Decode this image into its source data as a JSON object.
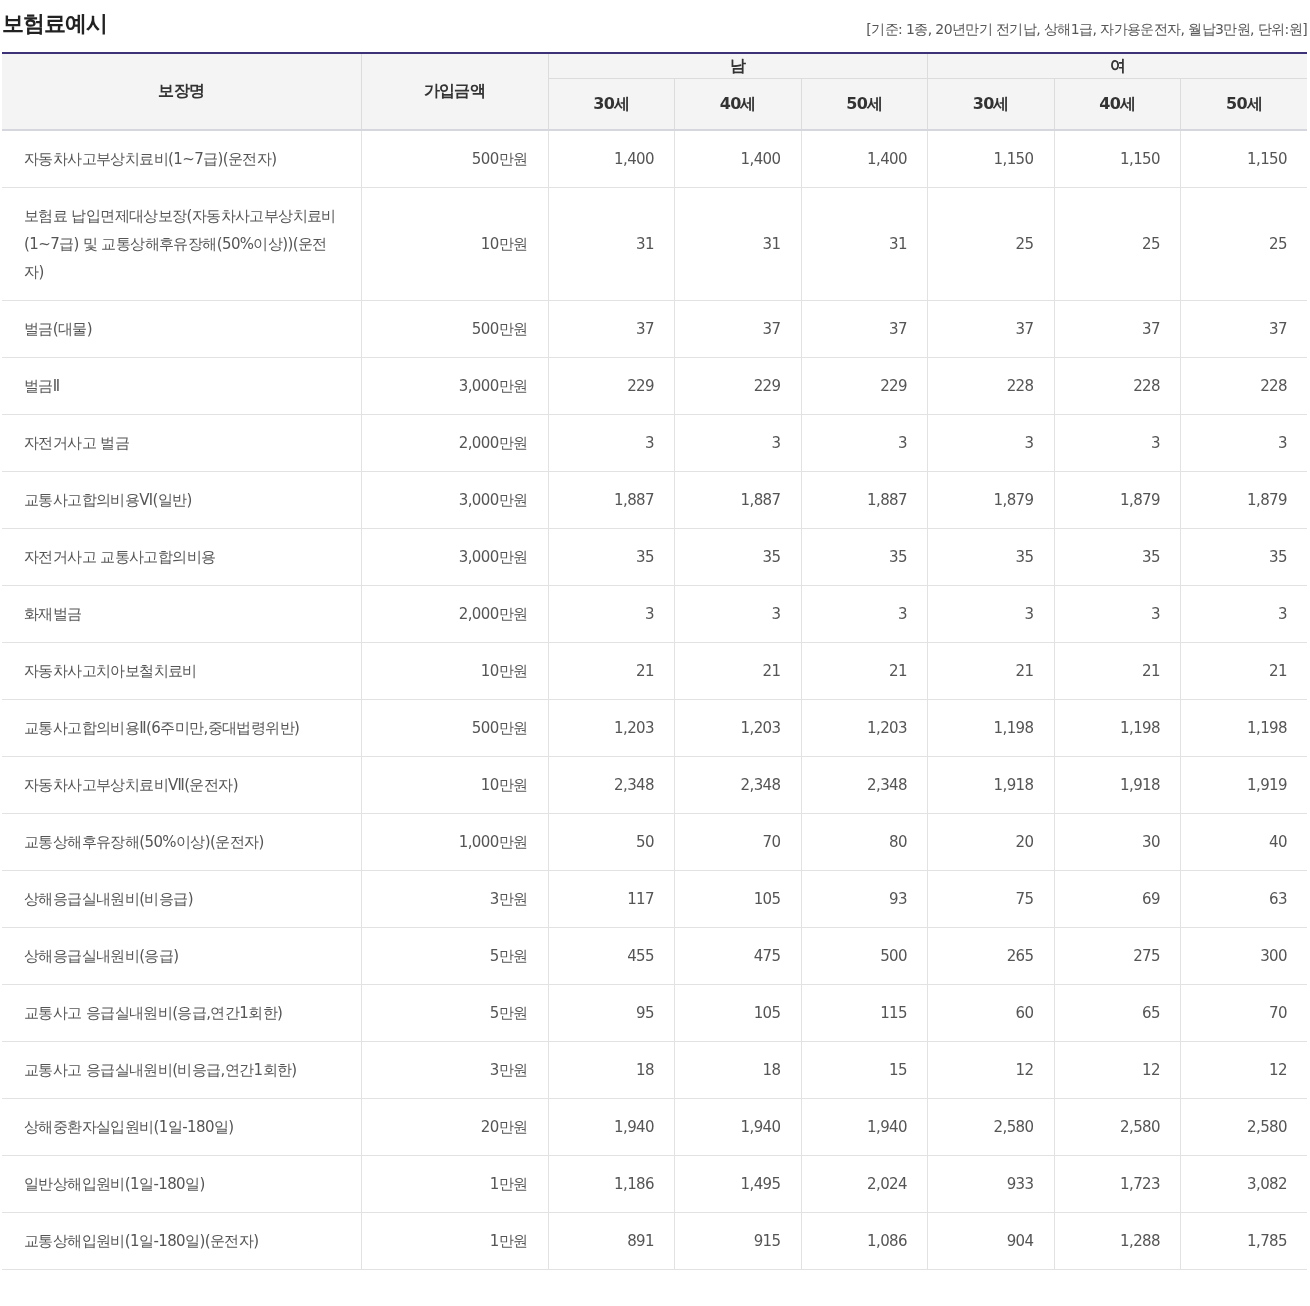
{
  "title": "보험료예시",
  "note": "[기준: 1종, 20년만기 전기납, 상해1급, 자가용운전자, 월납3만원, 단위:원]",
  "table": {
    "columns": {
      "coverage": "보장명",
      "amount": "가입금액",
      "groups": [
        {
          "label": "남",
          "ages": [
            "30세",
            "40세",
            "50세"
          ]
        },
        {
          "label": "여",
          "ages": [
            "30세",
            "40세",
            "50세"
          ]
        }
      ]
    },
    "rows": [
      {
        "name": "자동차사고부상치료비(1~7급)(운전자)",
        "amount": "500만원",
        "values": [
          "1,400",
          "1,400",
          "1,400",
          "1,150",
          "1,150",
          "1,150"
        ]
      },
      {
        "name": "보험료 납입면제대상보장(자동차사고부상치료비(1~7급) 및 교통상해후유장해(50%이상))(운전자)",
        "amount": "10만원",
        "values": [
          "31",
          "31",
          "31",
          "25",
          "25",
          "25"
        ]
      },
      {
        "name": "벌금(대물)",
        "amount": "500만원",
        "values": [
          "37",
          "37",
          "37",
          "37",
          "37",
          "37"
        ]
      },
      {
        "name": "벌금Ⅱ",
        "amount": "3,000만원",
        "values": [
          "229",
          "229",
          "229",
          "228",
          "228",
          "228"
        ]
      },
      {
        "name": "자전거사고 벌금",
        "amount": "2,000만원",
        "values": [
          "3",
          "3",
          "3",
          "3",
          "3",
          "3"
        ]
      },
      {
        "name": "교통사고합의비용Ⅵ(일반)",
        "amount": "3,000만원",
        "values": [
          "1,887",
          "1,887",
          "1,887",
          "1,879",
          "1,879",
          "1,879"
        ]
      },
      {
        "name": "자전거사고 교통사고합의비용",
        "amount": "3,000만원",
        "values": [
          "35",
          "35",
          "35",
          "35",
          "35",
          "35"
        ]
      },
      {
        "name": "화재벌금",
        "amount": "2,000만원",
        "values": [
          "3",
          "3",
          "3",
          "3",
          "3",
          "3"
        ]
      },
      {
        "name": "자동차사고치아보철치료비",
        "amount": "10만원",
        "values": [
          "21",
          "21",
          "21",
          "21",
          "21",
          "21"
        ]
      },
      {
        "name": "교통사고합의비용Ⅱ(6주미만,중대법령위반)",
        "amount": "500만원",
        "values": [
          "1,203",
          "1,203",
          "1,203",
          "1,198",
          "1,198",
          "1,198"
        ]
      },
      {
        "name": "자동차사고부상치료비Ⅶ(운전자)",
        "amount": "10만원",
        "values": [
          "2,348",
          "2,348",
          "2,348",
          "1,918",
          "1,918",
          "1,919"
        ]
      },
      {
        "name": "교통상해후유장해(50%이상)(운전자)",
        "amount": "1,000만원",
        "values": [
          "50",
          "70",
          "80",
          "20",
          "30",
          "40"
        ]
      },
      {
        "name": "상해응급실내원비(비응급)",
        "amount": "3만원",
        "values": [
          "117",
          "105",
          "93",
          "75",
          "69",
          "63"
        ]
      },
      {
        "name": "상해응급실내원비(응급)",
        "amount": "5만원",
        "values": [
          "455",
          "475",
          "500",
          "265",
          "275",
          "300"
        ]
      },
      {
        "name": "교통사고 응급실내원비(응급,연간1회한)",
        "amount": "5만원",
        "values": [
          "95",
          "105",
          "115",
          "60",
          "65",
          "70"
        ]
      },
      {
        "name": "교통사고 응급실내원비(비응급,연간1회한)",
        "amount": "3만원",
        "values": [
          "18",
          "18",
          "15",
          "12",
          "12",
          "12"
        ]
      },
      {
        "name": "상해중환자실입원비(1일-180일)",
        "amount": "20만원",
        "values": [
          "1,940",
          "1,940",
          "1,940",
          "2,580",
          "2,580",
          "2,580"
        ]
      },
      {
        "name": "일반상해입원비(1일-180일)",
        "amount": "1만원",
        "values": [
          "1,186",
          "1,495",
          "2,024",
          "933",
          "1,723",
          "3,082"
        ]
      },
      {
        "name": "교통상해입원비(1일-180일)(운전자)",
        "amount": "1만원",
        "values": [
          "891",
          "915",
          "1,086",
          "904",
          "1,288",
          "1,785"
        ]
      }
    ]
  }
}
